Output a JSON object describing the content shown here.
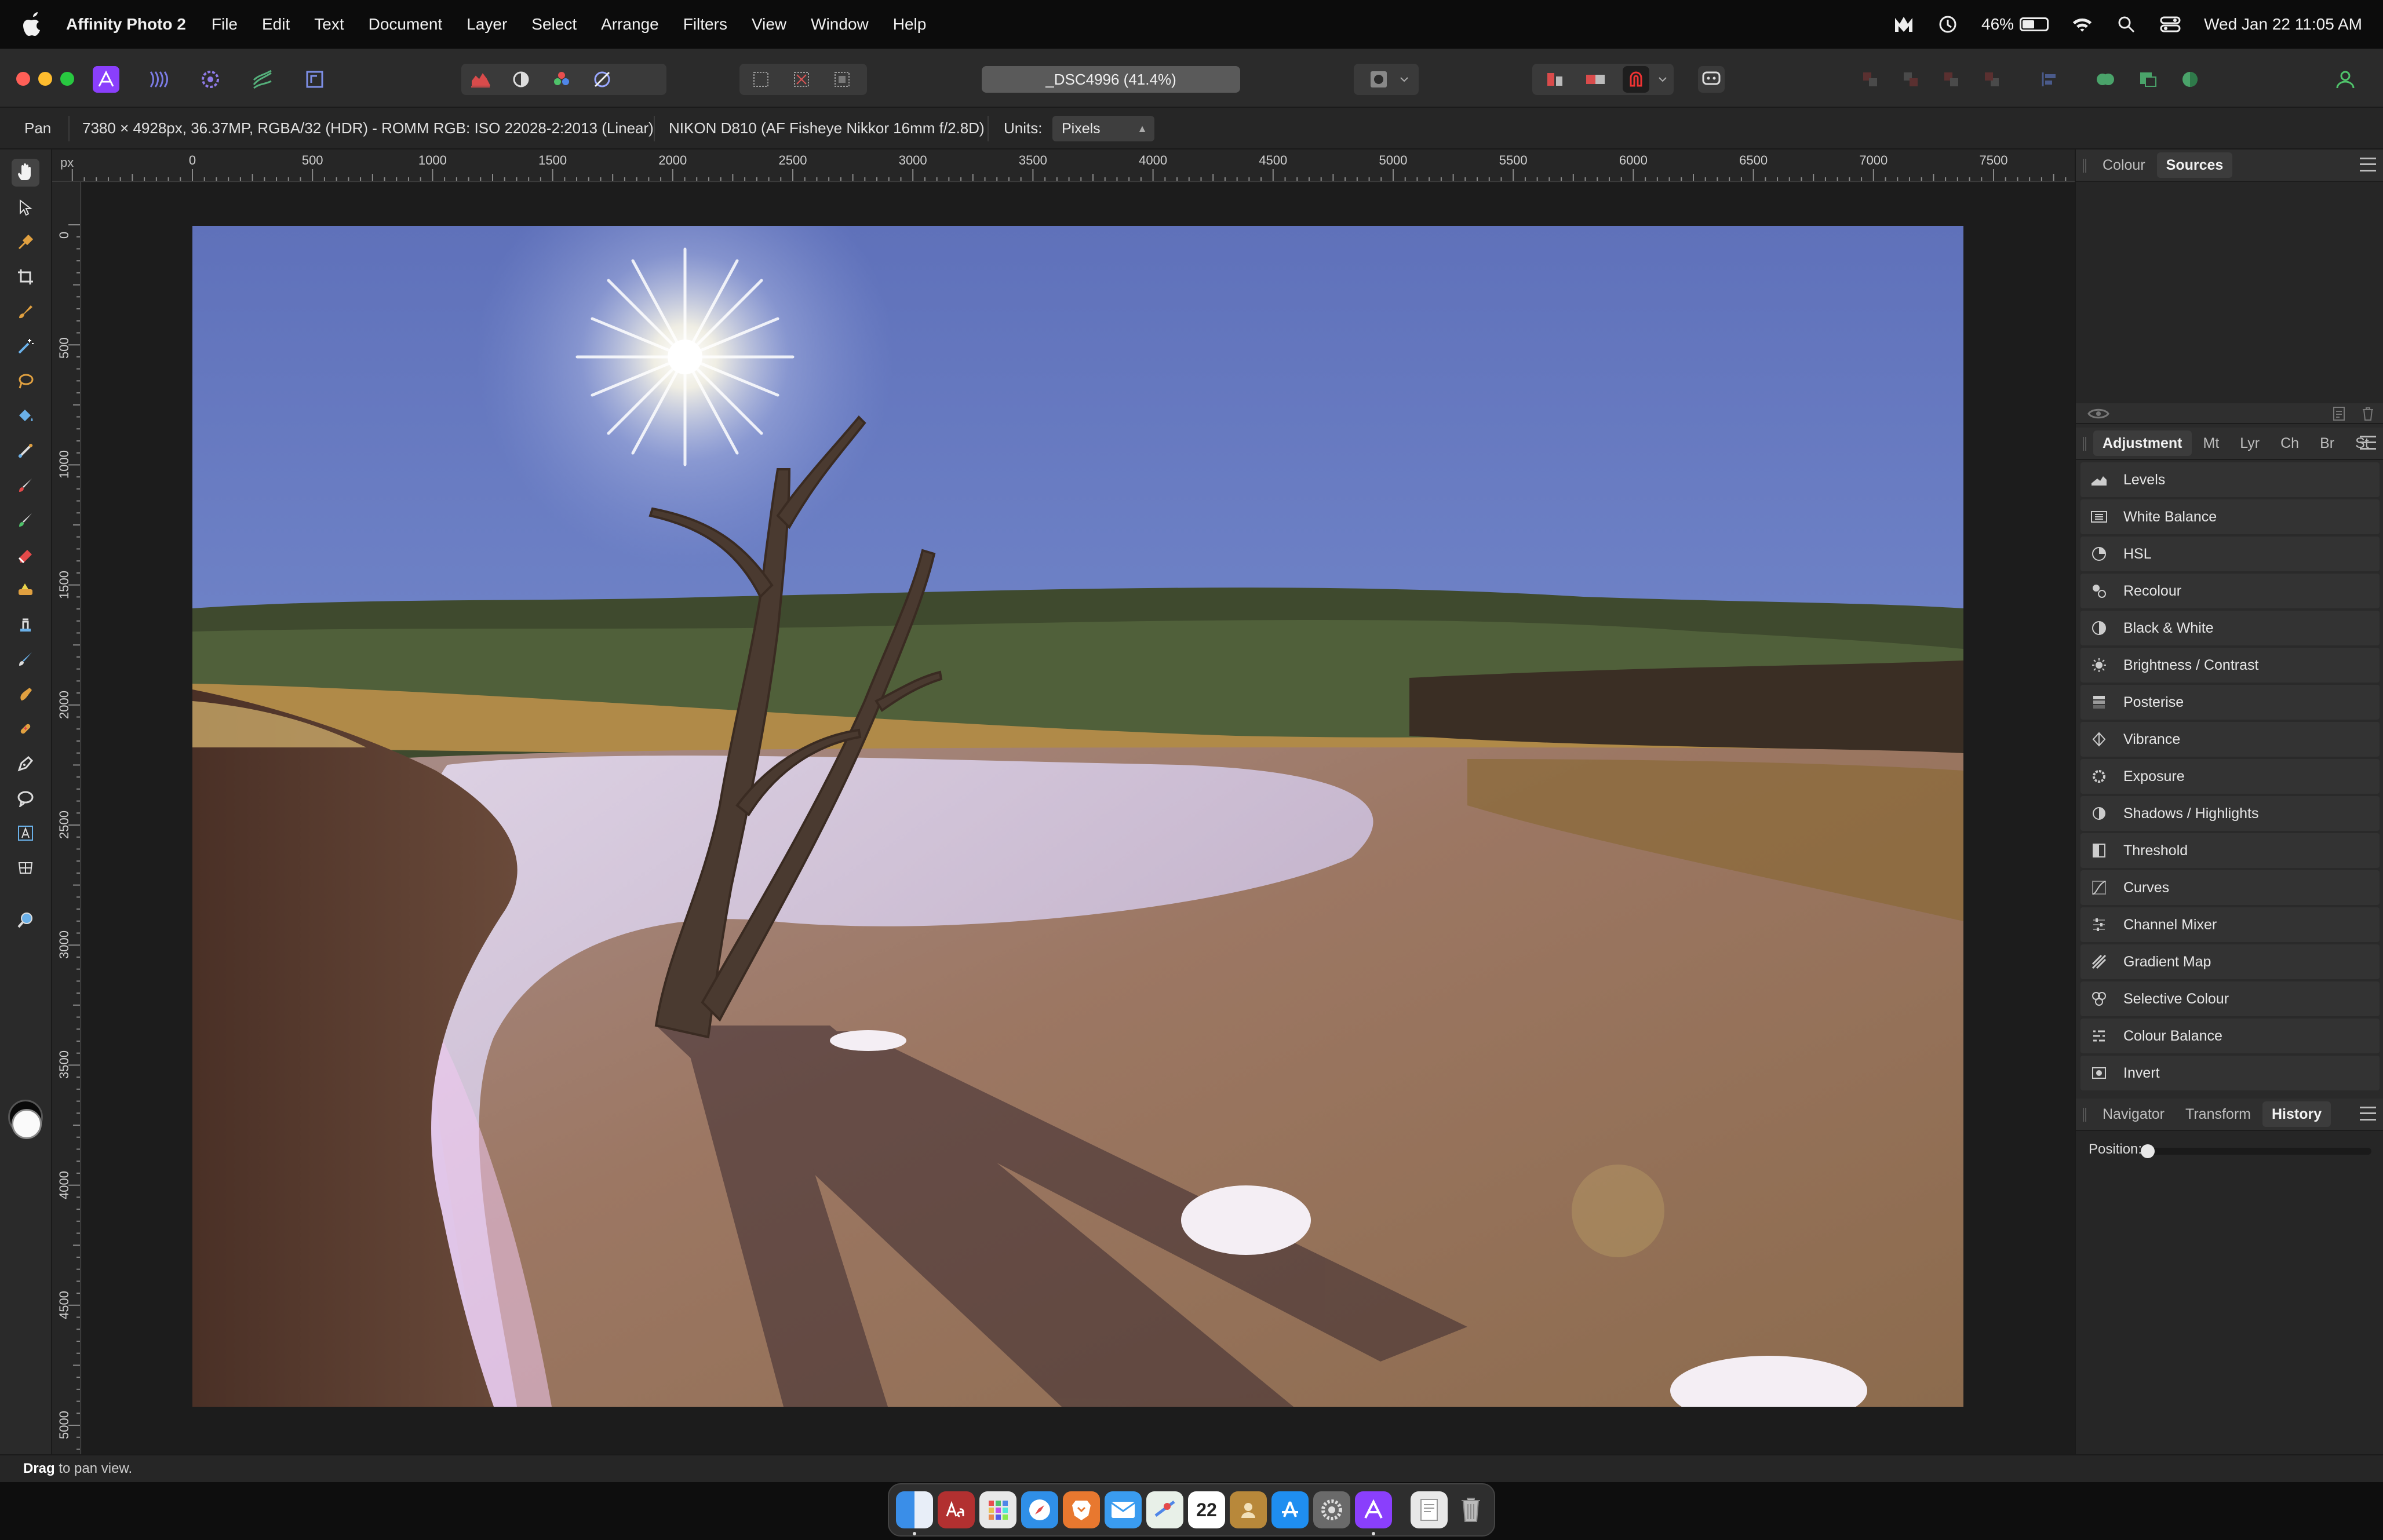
{
  "menubar": {
    "app_name": "Affinity Photo 2",
    "menus": [
      "File",
      "Edit",
      "Text",
      "Document",
      "Layer",
      "Select",
      "Arrange",
      "Filters",
      "View",
      "Window",
      "Help"
    ],
    "battery_percent": "46%",
    "battery_level": 0.46,
    "datetime": "Wed Jan 22  11:05 AM"
  },
  "toolbar": {
    "document_title": "_DSC4996 (41.4%)"
  },
  "context": {
    "tool_name": "Pan",
    "image_info": "7380 × 4928px, 36.37MP, RGBA/32 (HDR) - ROMM RGB: ISO 22028-2:2013 (Linear)",
    "camera_info": "NIKON D810 (AF Fisheye Nikkor 16mm f/2.8D)",
    "units_label": "Units:",
    "units_value": "Pixels"
  },
  "rulers": {
    "unit": "px",
    "top_labels": [
      "0",
      "500",
      "1000",
      "1500",
      "2000",
      "2500",
      "3000",
      "3500",
      "4000",
      "4500",
      "5000",
      "5500",
      "6000",
      "6500",
      "7000",
      "7500"
    ],
    "left_labels": [
      "0",
      "500",
      "1000",
      "1500",
      "2000",
      "2500",
      "3000",
      "3500",
      "4000",
      "4500",
      "5000"
    ]
  },
  "panels": {
    "top_tabs": [
      "Colour",
      "Sources"
    ],
    "top_active": "Sources",
    "studio_tabs": [
      "Adjustment",
      "Mt",
      "Lyr",
      "Ch",
      "Br",
      "St"
    ],
    "studio_active": "Adjustment",
    "adjustments": [
      {
        "label": "Levels",
        "icon": "levels-icon"
      },
      {
        "label": "White Balance",
        "icon": "white-balance-icon"
      },
      {
        "label": "HSL",
        "icon": "hsl-icon"
      },
      {
        "label": "Recolour",
        "icon": "recolour-icon"
      },
      {
        "label": "Black & White",
        "icon": "black-white-icon"
      },
      {
        "label": "Brightness / Contrast",
        "icon": "brightness-icon"
      },
      {
        "label": "Posterise",
        "icon": "posterise-icon"
      },
      {
        "label": "Vibrance",
        "icon": "vibrance-icon"
      },
      {
        "label": "Exposure",
        "icon": "exposure-icon"
      },
      {
        "label": "Shadows / Highlights",
        "icon": "shadows-highlights-icon"
      },
      {
        "label": "Threshold",
        "icon": "threshold-icon"
      },
      {
        "label": "Curves",
        "icon": "curves-icon"
      },
      {
        "label": "Channel Mixer",
        "icon": "channel-mixer-icon"
      },
      {
        "label": "Gradient Map",
        "icon": "gradient-map-icon"
      },
      {
        "label": "Selective Colour",
        "icon": "selective-colour-icon"
      },
      {
        "label": "Colour Balance",
        "icon": "colour-balance-icon"
      },
      {
        "label": "Invert",
        "icon": "invert-icon"
      }
    ],
    "bottom_tabs": [
      "Navigator",
      "Transform",
      "History"
    ],
    "bottom_active": "History",
    "history_position_label": "Position:",
    "history_position": 0.0
  },
  "statusbar": {
    "bold": "Drag",
    "text": " to pan view."
  },
  "colors": {
    "accent": "#8a3ffc",
    "traffic_close": "#ff5f57",
    "traffic_min": "#febc2e",
    "traffic_max": "#28c840"
  }
}
